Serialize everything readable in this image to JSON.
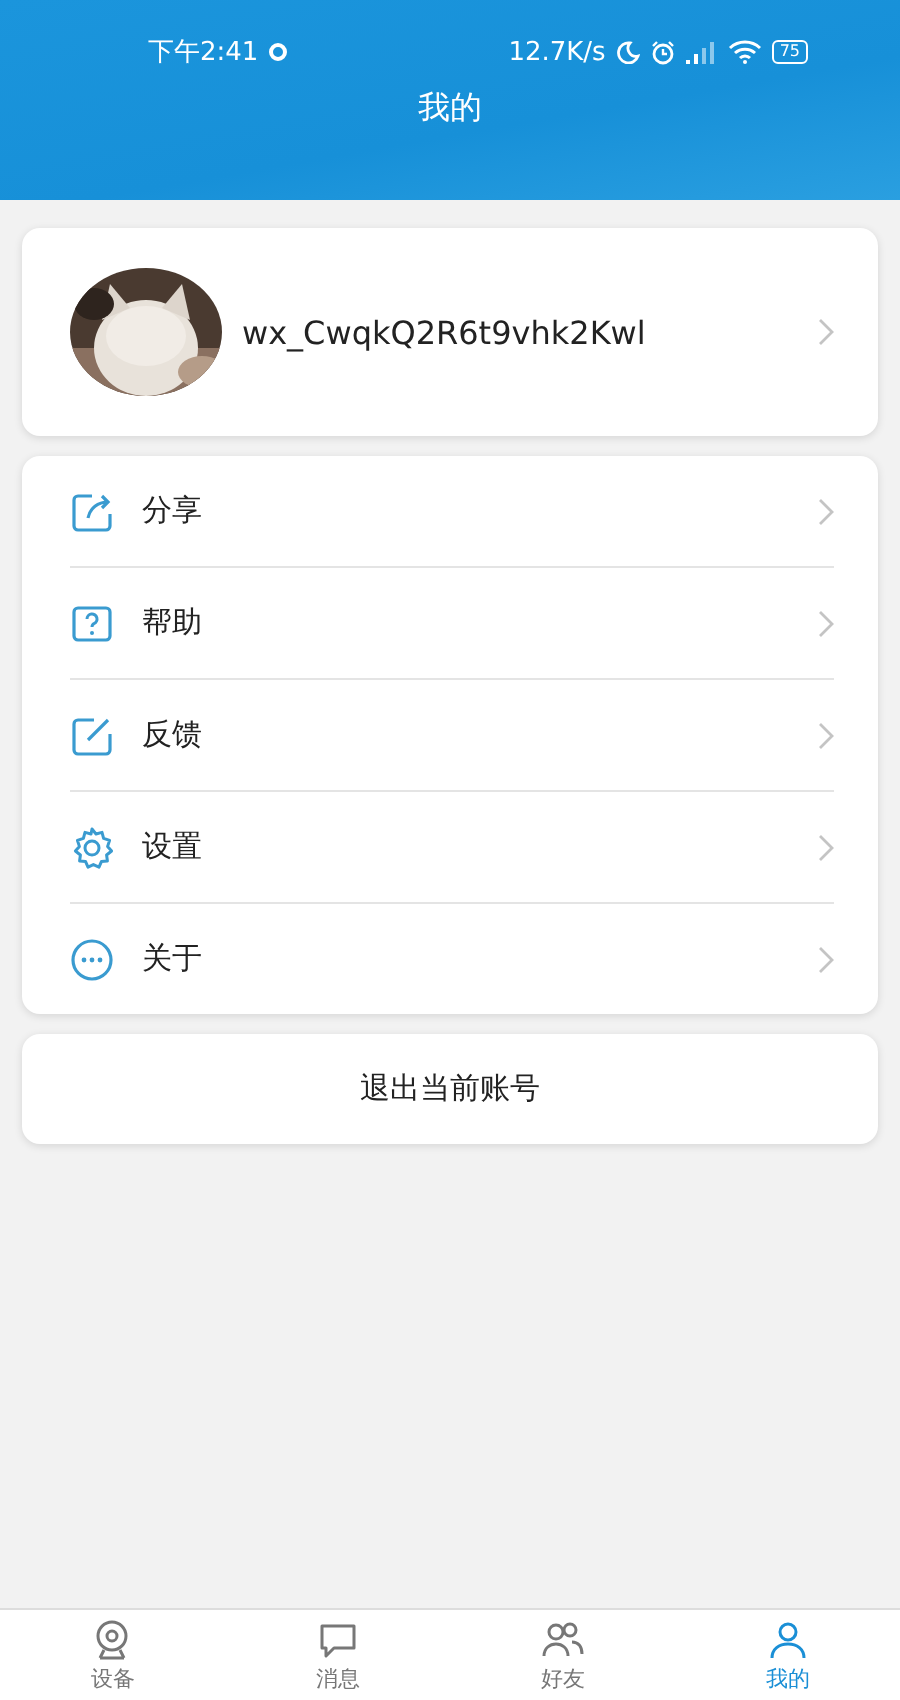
{
  "status_bar": {
    "time": "下午2:41",
    "speed": "12.7K/s",
    "battery": "75"
  },
  "header": {
    "title": "我的"
  },
  "profile": {
    "username": "wx_CwqkQ2R6t9vhk2Kwl"
  },
  "menu": [
    {
      "kind": "share",
      "label": "分享"
    },
    {
      "kind": "help",
      "label": "帮助"
    },
    {
      "kind": "feedback",
      "label": "反馈"
    },
    {
      "kind": "settings",
      "label": "设置"
    },
    {
      "kind": "about",
      "label": "关于"
    }
  ],
  "logout_button": "退出当前账号",
  "tab_bar": [
    {
      "kind": "device",
      "label": "设备",
      "selected": false
    },
    {
      "kind": "message",
      "label": "消息",
      "selected": false
    },
    {
      "kind": "friends",
      "label": "好友",
      "selected": false
    },
    {
      "kind": "me",
      "label": "我的",
      "selected": true
    }
  ]
}
